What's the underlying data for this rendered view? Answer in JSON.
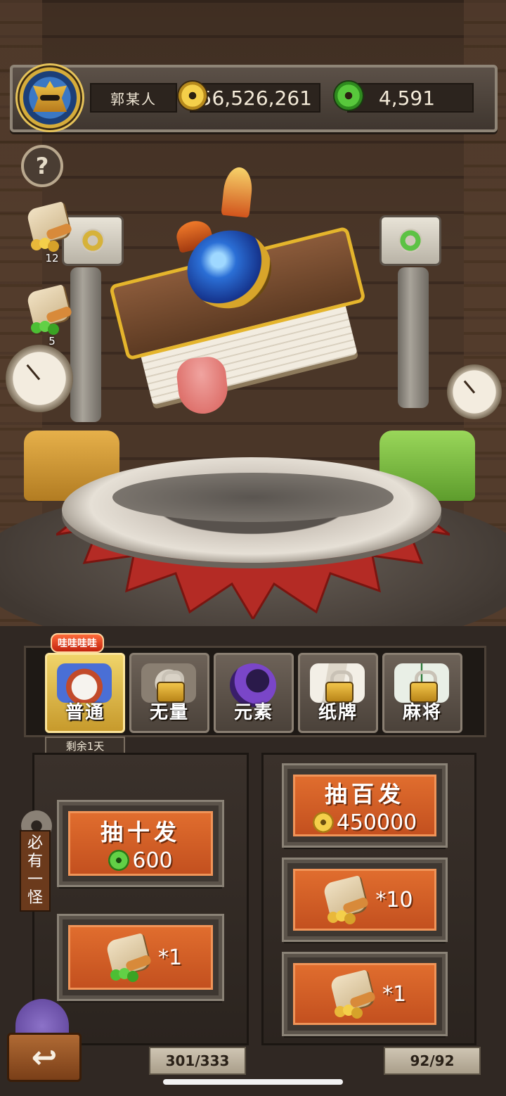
{
  "player": {
    "name": "郭某人",
    "gold": "56,526,261",
    "gems": "4,591"
  },
  "help_label": "?",
  "side_tickets": [
    {
      "count": "12",
      "type": "gold"
    },
    {
      "count": "5",
      "type": "green"
    }
  ],
  "tabs": [
    {
      "label": "普通",
      "locked": false,
      "active": true
    },
    {
      "label": "无量",
      "locked": true,
      "active": false
    },
    {
      "label": "元素",
      "locked": false,
      "active": false
    },
    {
      "label": "纸牌",
      "locked": true,
      "active": false
    },
    {
      "label": "麻将",
      "locked": true,
      "active": false
    }
  ],
  "hot_badge": "哇哇哇哇",
  "remaining": "剩余1天",
  "guarantee_tag": [
    "必",
    "有",
    "一",
    "怪"
  ],
  "left_buttons": {
    "ten_draw": {
      "title": "抽十发",
      "cost": "600",
      "currency": "green-gem"
    },
    "ticket_draw": {
      "label": "*1",
      "ticket": "green-ticket"
    }
  },
  "right_buttons": {
    "hundred_draw": {
      "title": "抽百发",
      "cost": "450000",
      "currency": "gold-coin"
    },
    "ticket_ten": {
      "label": "*10",
      "ticket": "gold-ticket"
    },
    "ticket_one": {
      "label": "*1",
      "ticket": "gold-ticket"
    }
  },
  "counters": {
    "left": "301/333",
    "right": "92/92"
  },
  "back_label": "↩",
  "colors": {
    "accent_orange": "#c3501f",
    "gold": "#f4cf4a",
    "green": "#58c83c"
  }
}
